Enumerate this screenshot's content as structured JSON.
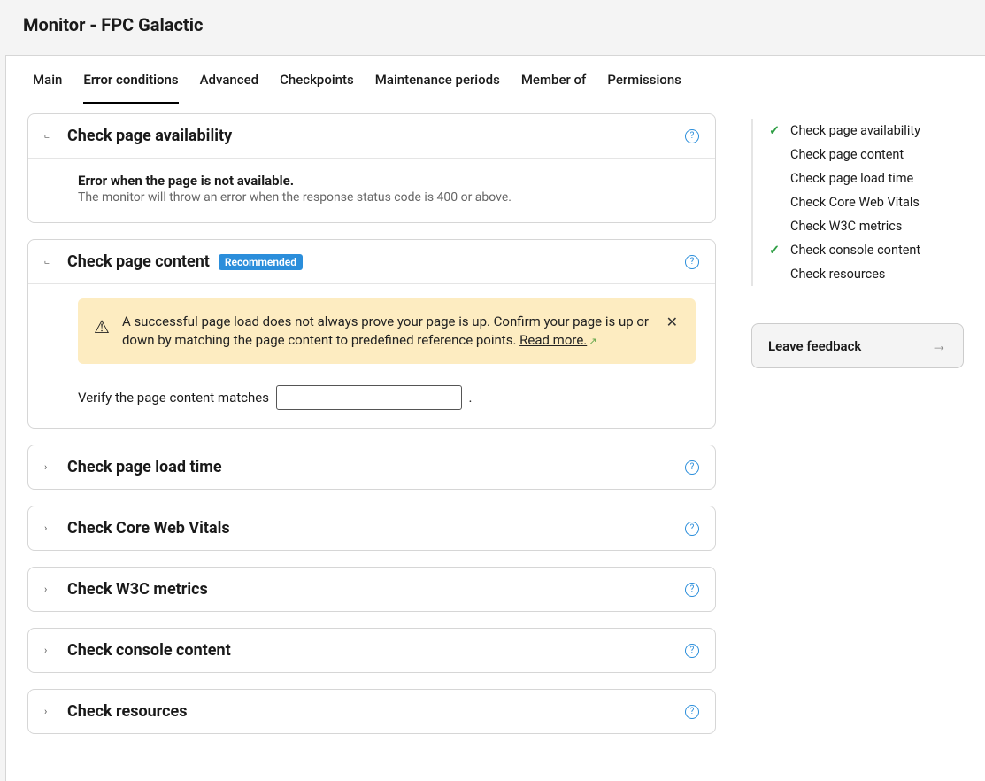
{
  "header": {
    "title": "Monitor - FPC Galactic"
  },
  "tabs": [
    {
      "label": "Main",
      "active": false
    },
    {
      "label": "Error conditions",
      "active": true
    },
    {
      "label": "Advanced",
      "active": false
    },
    {
      "label": "Checkpoints",
      "active": false
    },
    {
      "label": "Maintenance periods",
      "active": false
    },
    {
      "label": "Member of",
      "active": false
    },
    {
      "label": "Permissions",
      "active": false
    }
  ],
  "panels": {
    "availability": {
      "title": "Check page availability",
      "sub_heading": "Error when the page is not available.",
      "sub_text": "The monitor will throw an error when the response status code is 400 or above."
    },
    "content": {
      "title": "Check page content",
      "badge": "Recommended",
      "alert_text": "A successful page load does not always prove your page is up. Confirm your page is up or down by matching the page content to predefined reference points. ",
      "alert_link": "Read more.",
      "form_prefix": "Verify the page content matches",
      "form_value": "",
      "form_suffix": "."
    },
    "loadtime": {
      "title": "Check page load time"
    },
    "cwv": {
      "title": "Check Core Web Vitals"
    },
    "w3c": {
      "title": "Check W3C metrics"
    },
    "console": {
      "title": "Check console content"
    },
    "resources": {
      "title": "Check resources"
    }
  },
  "sidebar_nav": [
    {
      "label": "Check page availability",
      "checked": true
    },
    {
      "label": "Check page content",
      "checked": false
    },
    {
      "label": "Check page load time",
      "checked": false
    },
    {
      "label": "Check Core Web Vitals",
      "checked": false
    },
    {
      "label": "Check W3C metrics",
      "checked": false
    },
    {
      "label": "Check console content",
      "checked": true
    },
    {
      "label": "Check resources",
      "checked": false
    }
  ],
  "feedback_label": "Leave feedback",
  "glyphs": {
    "chevron_expanded": "⌐",
    "chevron_collapsed": "›",
    "help": "?",
    "warning": "⚠",
    "external": "↗",
    "close": "✕",
    "check": "✓",
    "arrow_right": "→"
  }
}
